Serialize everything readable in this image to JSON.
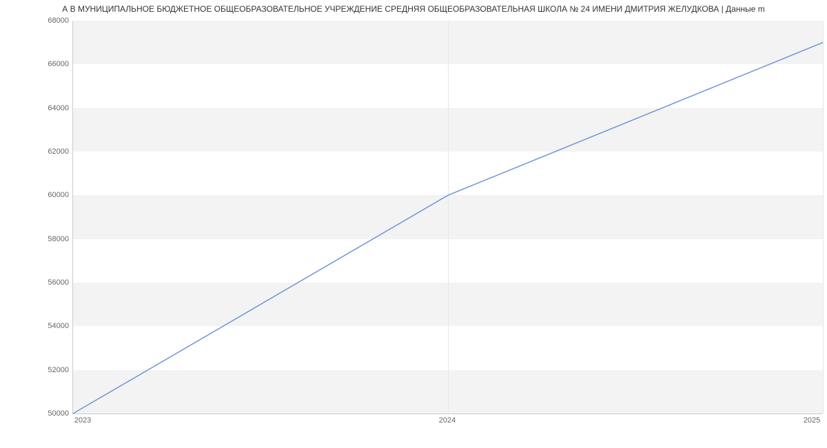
{
  "chart_data": {
    "type": "line",
    "title": "А В МУНИЦИПАЛЬНОЕ БЮДЖЕТНОЕ ОБЩЕОБРАЗОВАТЕЛЬНОЕ УЧРЕЖДЕНИЕ СРЕДНЯЯ ОБЩЕОБРАЗОВАТЕЛЬНАЯ ШКОЛА № 24 ИМЕНИ ДМИТРИЯ ЖЕЛУДКОВА | Данные m",
    "x": [
      2023,
      2024,
      2025
    ],
    "values": [
      50000,
      60000,
      67000
    ],
    "xlabel": "",
    "ylabel": "",
    "xlim": [
      2023,
      2025
    ],
    "ylim": [
      50000,
      68000
    ],
    "x_ticks": [
      "2023",
      "2024",
      "2025"
    ],
    "y_ticks": [
      "50000",
      "52000",
      "54000",
      "56000",
      "58000",
      "60000",
      "62000",
      "64000",
      "66000",
      "68000"
    ]
  }
}
